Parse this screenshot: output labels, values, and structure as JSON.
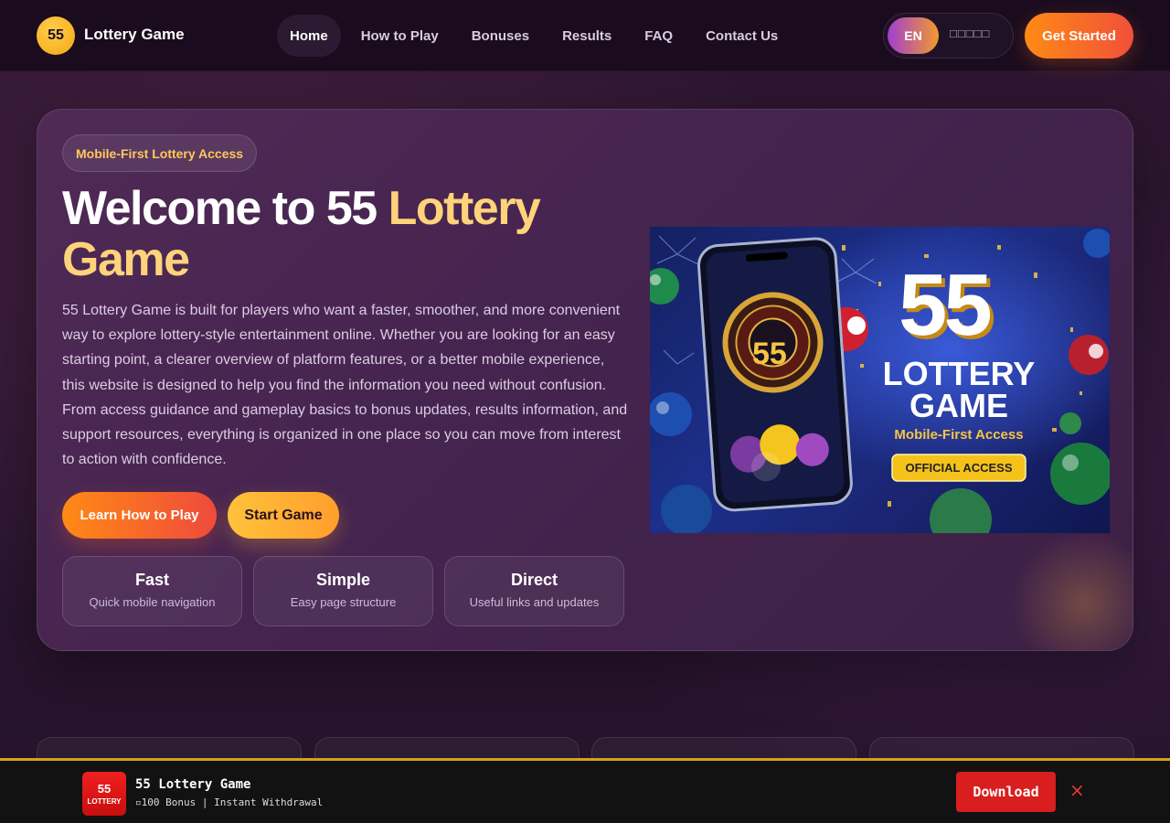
{
  "header": {
    "logo_text": "55",
    "brand": "Lottery Game",
    "nav": [
      "Home",
      "How to Play",
      "Bonuses",
      "Results",
      "FAQ",
      "Contact Us"
    ],
    "active_nav": "Home",
    "lang_selected": "EN",
    "lang_other": "□□□□□",
    "cta": "Get Started"
  },
  "hero": {
    "badge": "Mobile-First Lottery Access",
    "title_part1": "Welcome to 55 ",
    "title_part2": "Lottery Game",
    "description": "55 Lottery Game is built for players who want a faster, smoother, and more convenient way to explore lottery-style entertainment online. Whether you are looking for an easy starting point, a clearer overview of platform features, or a better mobile experience, this website is designed to help you find the information you need without confusion. From access guidance and gameplay basics to bonus updates, results information, and support resources, everything is organized in one place so you can move from interest to action with confidence.",
    "btn_learn": "Learn How to Play",
    "btn_start": "Start Game",
    "features": [
      {
        "title": "Fast",
        "desc": "Quick mobile navigation"
      },
      {
        "title": "Simple",
        "desc": "Easy page structure"
      },
      {
        "title": "Direct",
        "desc": "Useful links and updates"
      }
    ]
  },
  "banner": {
    "big_number": "55",
    "line1": "LOTTERY",
    "line2": "GAME",
    "tagline": "Mobile-First Access",
    "button": "OFFICIAL ACCESS",
    "phone_number": "55"
  },
  "download_bar": {
    "logo_number": "55",
    "logo_text": "LOTTERY",
    "title": "55 Lottery Game",
    "subtitle": "▫100 Bonus | Instant Withdrawal",
    "button": "Download",
    "close": "×"
  },
  "colors": {
    "accent_orange": "#ff8a14",
    "accent_gold": "#ffc95a",
    "card_bg": "#4a2750",
    "download_red": "#d81e1e"
  }
}
